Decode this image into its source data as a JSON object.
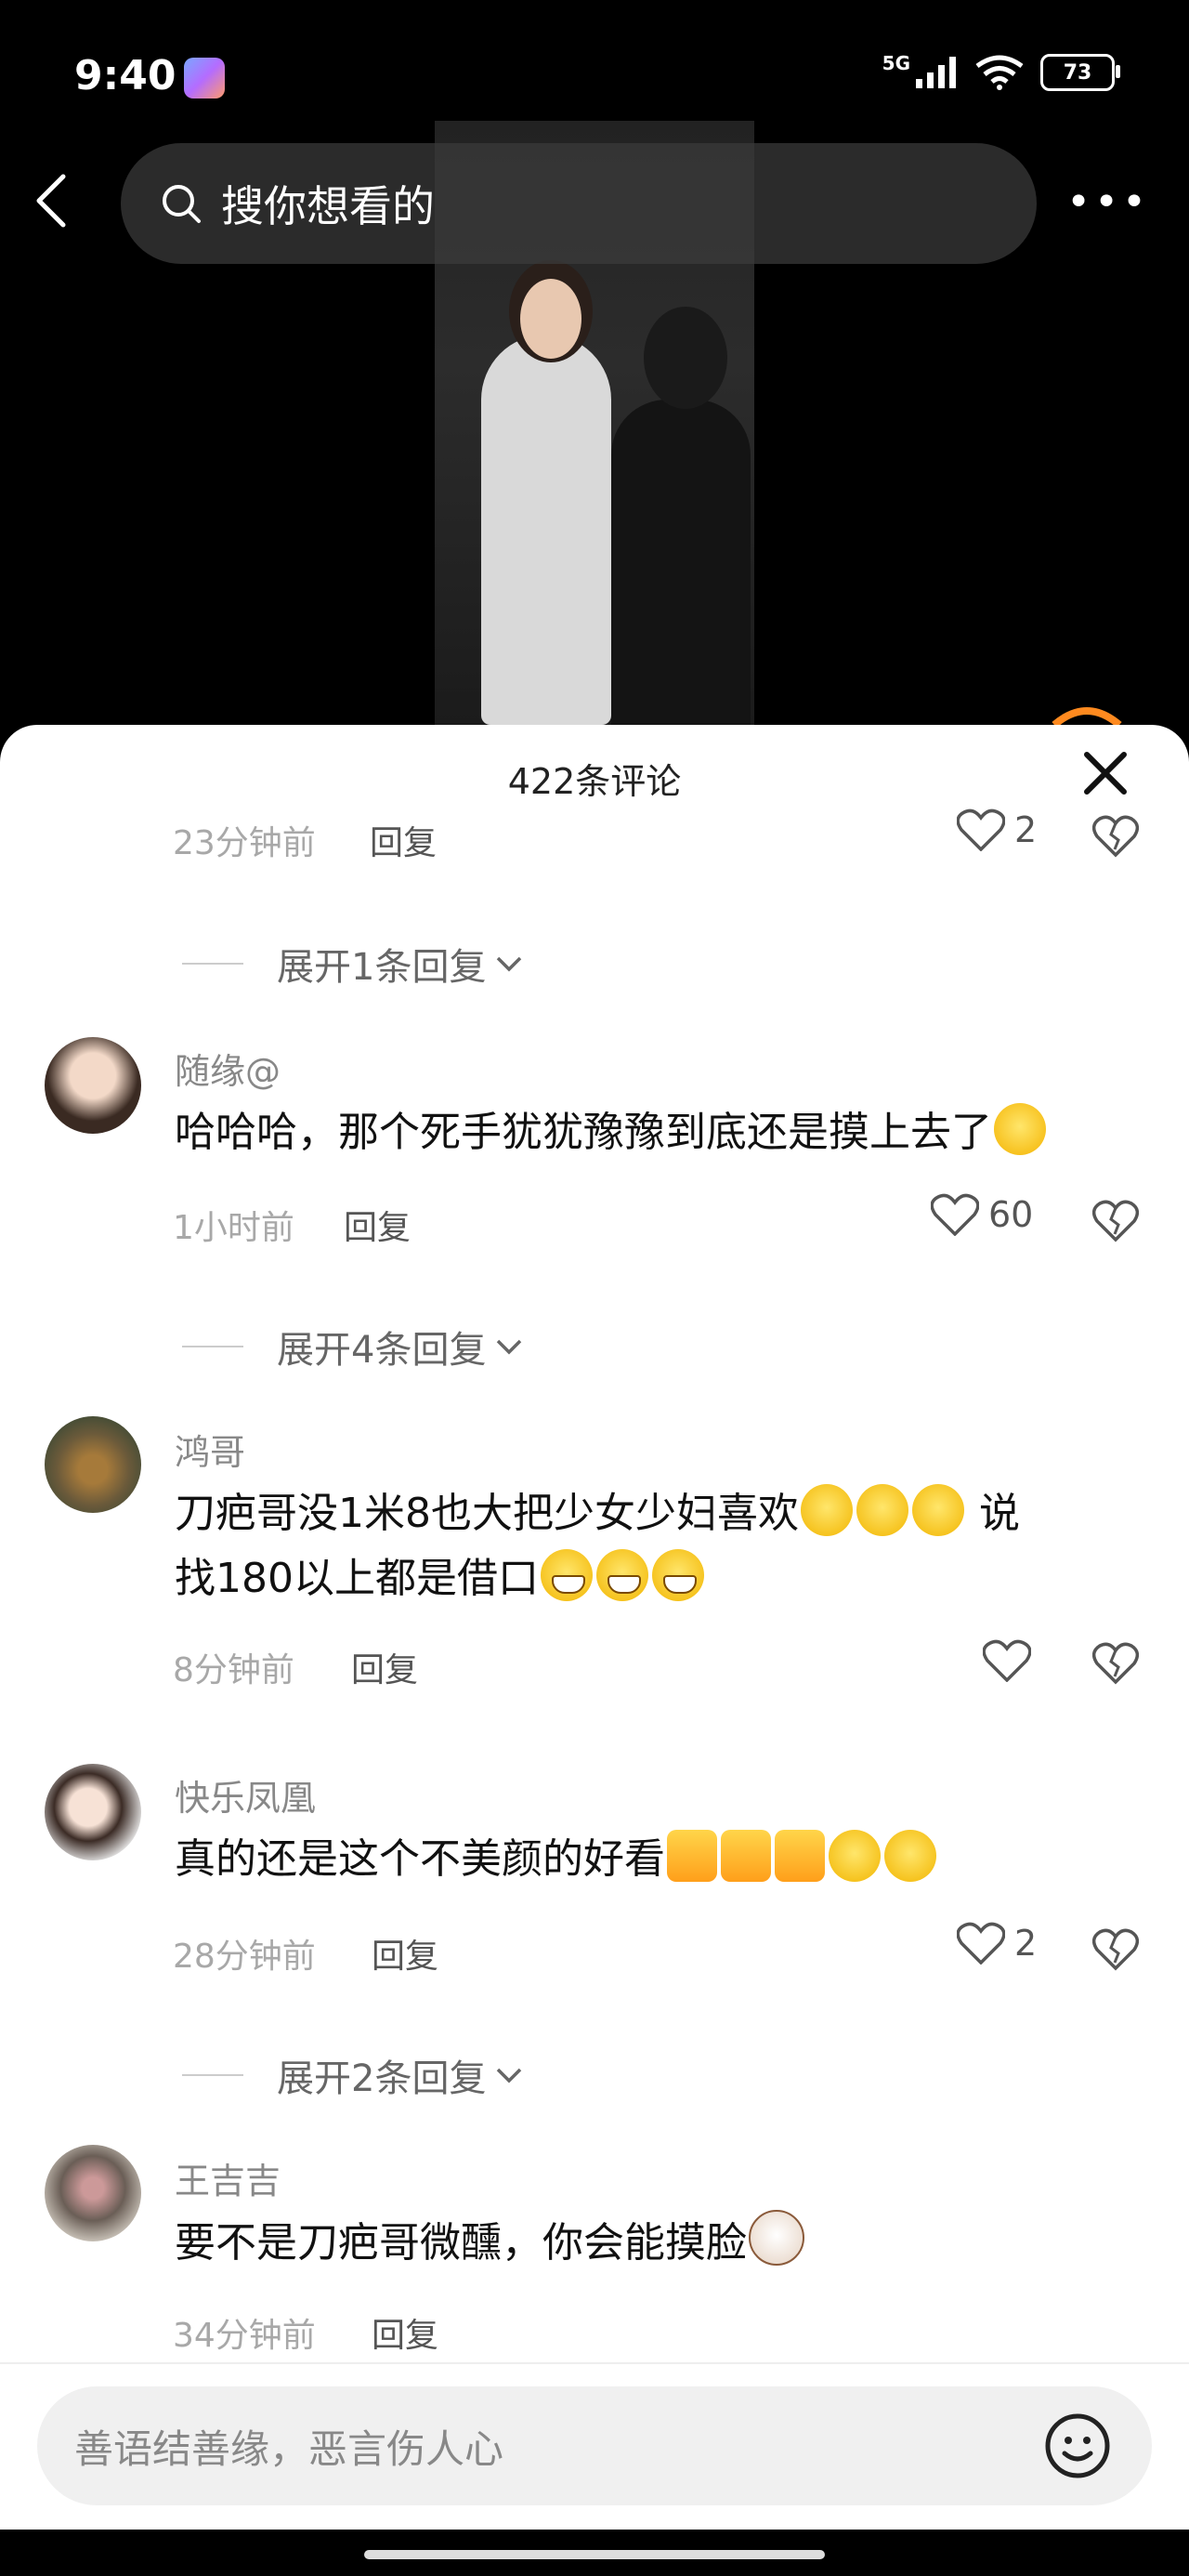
{
  "status": {
    "time": "9:40",
    "network": "5G",
    "battery": "73"
  },
  "search": {
    "placeholder": "搜你想看的"
  },
  "sheet": {
    "title": "422条评论"
  },
  "comments": [
    {
      "time": "23分钟前",
      "reply": "回复",
      "likes": "2"
    },
    {
      "expand": "展开1条回复"
    },
    {
      "username": "随缘@",
      "text": "哈哈哈，那个死手犹犹豫豫到底还是摸上去了",
      "time": "1小时前",
      "reply": "回复",
      "likes": "60",
      "emojis": [
        "laugh"
      ]
    },
    {
      "expand": "展开4条回复"
    },
    {
      "username": "鸿哥",
      "text_line1": "刀疤哥没1米8也大把少女少妇喜欢",
      "text_line1b": "说",
      "text_line2": "找180以上都是借口",
      "time": "8分钟前",
      "reply": "回复",
      "likes": "",
      "emojis": [
        "smile",
        "smile",
        "smile",
        "grin",
        "grin",
        "grin"
      ]
    },
    {
      "username": "快乐凤凰",
      "text": "真的还是这个不美颜的好看",
      "time": "28分钟前",
      "reply": "回复",
      "likes": "2",
      "emojis": [
        "thumb",
        "thumb",
        "thumb",
        "hug",
        "hug"
      ]
    },
    {
      "expand": "展开2条回复"
    },
    {
      "username": "王吉吉",
      "text": "要不是刀疤哥微醺，你会能摸脸",
      "time": "34分钟前",
      "reply": "回复",
      "emojis": [
        "cat"
      ]
    }
  ],
  "input": {
    "placeholder": "善语结善缘，恶言伤人心"
  },
  "icons": [
    "back-icon",
    "search-icon",
    "more-icon",
    "close-icon",
    "heart-icon",
    "dislike-icon",
    "chevron-down-icon",
    "emoji-icon"
  ]
}
